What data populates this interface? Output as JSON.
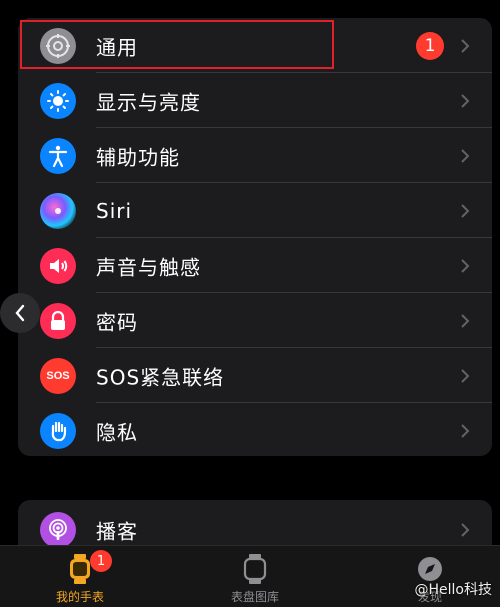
{
  "settings": {
    "items": [
      {
        "label": "通用",
        "icon": "gear-icon",
        "color": "#8e8e93",
        "badge": "1"
      },
      {
        "label": "显示与亮度",
        "icon": "sun-icon",
        "color": "#0a84ff"
      },
      {
        "label": "辅助功能",
        "icon": "accessibility-icon",
        "color": "#0a84ff"
      },
      {
        "label": "Siri",
        "icon": "siri-icon",
        "color": "#1c1c1e"
      },
      {
        "label": "声音与触感",
        "icon": "speaker-icon",
        "color": "#ff2d55"
      },
      {
        "label": "密码",
        "icon": "lock-icon",
        "color": "#ff2d55"
      },
      {
        "label": "SOS紧急联络",
        "icon": "sos-icon",
        "icon_text": "SOS",
        "color": "#ff3b30"
      },
      {
        "label": "隐私",
        "icon": "hand-icon",
        "color": "#0a84ff"
      }
    ],
    "second_group": [
      {
        "label": "播客",
        "icon": "podcast-icon",
        "color": "#b150e2"
      }
    ]
  },
  "tabbar": {
    "tabs": [
      {
        "label": "我的手表",
        "icon": "watch-icon",
        "active": true,
        "badge": "1"
      },
      {
        "label": "表盘图库",
        "icon": "watch-face-icon",
        "active": false
      },
      {
        "label": "发现",
        "icon": "compass-icon",
        "active": false
      }
    ]
  },
  "watermark": "@Hello科技",
  "colors": {
    "highlight": "#e0202a",
    "accent": "#f5a623",
    "badge": "#ff3b30"
  }
}
